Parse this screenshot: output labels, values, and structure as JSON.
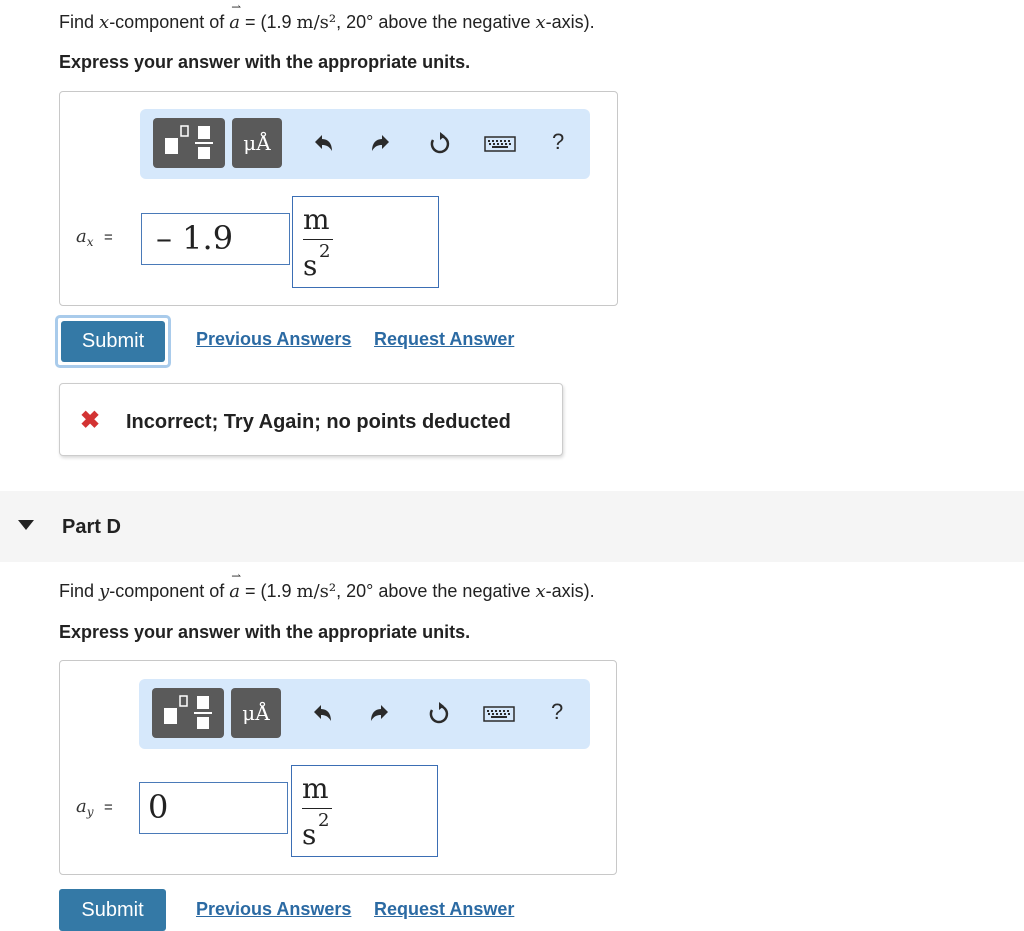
{
  "partC": {
    "question": {
      "prefix": "Find ",
      "var": "x",
      "mid": "-component of ",
      "vec": "a",
      "arrow": "⇀",
      "eq": " = (1.9 ",
      "unit": "m/s²",
      "after": ", 20° above the negative ",
      "axisVar": "x",
      "end": "-axis)."
    },
    "instruction": "Express your answer with the appropriate units.",
    "label_var": "a",
    "label_sub": "x",
    "equals": "=",
    "value": "– 1.9",
    "unit_num": "m",
    "unit_den": "s",
    "unit_exp": "2",
    "submit": "Submit",
    "previous_answers": "Previous Answers",
    "request_answer": "Request Answer",
    "feedback_icon": "✖",
    "feedback_text": "Incorrect; Try Again; no points deducted"
  },
  "partD": {
    "title": "Part D",
    "question": {
      "prefix": "Find ",
      "var": "y",
      "mid": "-component of ",
      "vec": "a",
      "arrow": "⇀",
      "eq": " = (1.9 ",
      "unit": "m/s²",
      "after": ", 20° above the negative ",
      "axisVar": "x",
      "end": "-axis)."
    },
    "instruction": "Express your answer with the appropriate units.",
    "label_var": "a",
    "label_sub": "y",
    "equals": "=",
    "value": "0",
    "unit_num": "m",
    "unit_den": "s",
    "unit_exp": "2",
    "submit": "Submit",
    "previous_answers": "Previous Answers",
    "request_answer": "Request Answer"
  },
  "toolbar": {
    "units_label": "μÅ",
    "help_label": "?"
  },
  "colors": {
    "toolbar_bg": "#d6e8fb",
    "submit_bg": "#3479a6",
    "link": "#2b6aa3",
    "error": "#d33333"
  }
}
